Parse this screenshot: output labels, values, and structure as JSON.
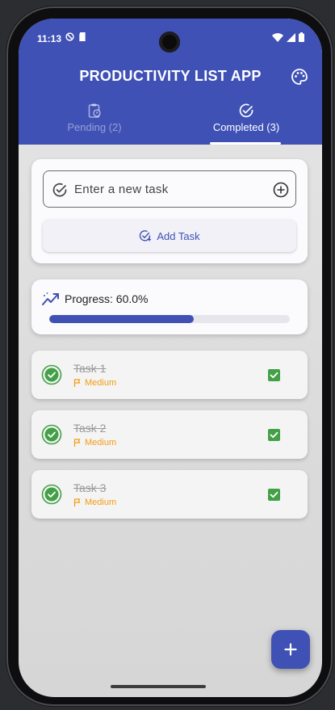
{
  "status_bar": {
    "time": "11:13"
  },
  "app": {
    "title": "PRODUCTIVITY LIST APP"
  },
  "tabs": [
    {
      "label": "Pending (2)",
      "icon": "clipboard-clock-icon",
      "selected": false
    },
    {
      "label": "Completed (3)",
      "icon": "check-circle-icon",
      "selected": true
    }
  ],
  "task_input": {
    "placeholder": "Enter a new task",
    "value": ""
  },
  "add_button": {
    "label": "Add Task"
  },
  "progress": {
    "label": "Progress: 60.0%",
    "value": 0.6
  },
  "tasks": [
    {
      "name": "Task 1",
      "priority": "Medium",
      "completed": true
    },
    {
      "name": "Task 2",
      "priority": "Medium",
      "completed": true
    },
    {
      "name": "Task 3",
      "priority": "Medium",
      "completed": true
    }
  ],
  "fab": {
    "label": "+"
  },
  "colors": {
    "primary": "#3f51b5",
    "priority": "#f39c12",
    "done": "#43a047"
  }
}
